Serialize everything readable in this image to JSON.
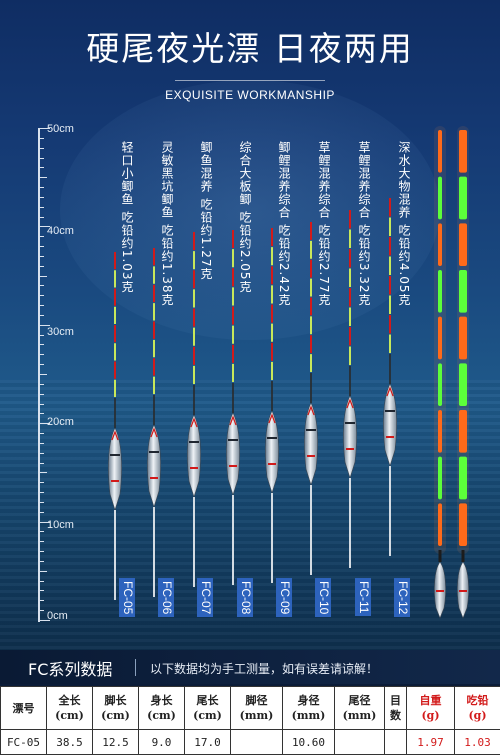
{
  "page": {
    "title": "硬尾夜光漂 日夜两用",
    "subtitle": "EXQUISITE WORKMANSHIP"
  },
  "ruler": {
    "labels": [
      "50cm",
      "40cm",
      "30cm",
      "20cm",
      "10cm",
      "0cm"
    ]
  },
  "floats": [
    {
      "name": "轻口小鲫鱼 吃铅约1.03克",
      "model": "FC-05"
    },
    {
      "name": "灵敏黑坑鲫鱼 吃铅约1.38克",
      "model": "FC-06"
    },
    {
      "name": "鲫鱼混养 吃铅约1.27克",
      "model": "FC-07"
    },
    {
      "name": "综合大板鲫 吃铅约2.05克",
      "model": "FC-08"
    },
    {
      "name": "鲫鲤混养综合 吃铅约2.42克",
      "model": "FC-09"
    },
    {
      "name": "草鲤混养综合 吃铅约2.77克",
      "model": "FC-10"
    },
    {
      "name": "草鲤混养综合 吃铅约3.32克",
      "model": "FC-11"
    },
    {
      "name": "深水大物混养 吃铅约4.05克",
      "model": "FC-12"
    }
  ],
  "section": {
    "title": "FC系列数据",
    "note": "以下数据均为手工测量，如有误差请谅解！"
  },
  "table": {
    "headers": [
      {
        "l1": "漂号",
        "l2": ""
      },
      {
        "l1": "全长",
        "l2": "(cm)"
      },
      {
        "l1": "脚长",
        "l2": "(cm)"
      },
      {
        "l1": "身长",
        "l2": "(cm)"
      },
      {
        "l1": "尾长",
        "l2": "(cm)"
      },
      {
        "l1": "脚径",
        "l2": "(mm)"
      },
      {
        "l1": "身径",
        "l2": "(mm)"
      },
      {
        "l1": "尾径",
        "l2": "(mm)"
      },
      {
        "l1": "目",
        "l2": "数"
      },
      {
        "l1": "自重",
        "l2": "(g)"
      },
      {
        "l1": "吃铅",
        "l2": "(g)"
      }
    ],
    "rows": [
      [
        "FC-05",
        "38.5",
        "12.5",
        "9.0",
        "17.0",
        "",
        "10.60",
        "",
        "",
        "1.97",
        "1.03"
      ]
    ]
  },
  "colors": {
    "accent_red": "#d21a1a",
    "model_tag": "#2d63bd",
    "glow_orange": "#ff6a1a",
    "glow_green": "#5cff3a"
  }
}
